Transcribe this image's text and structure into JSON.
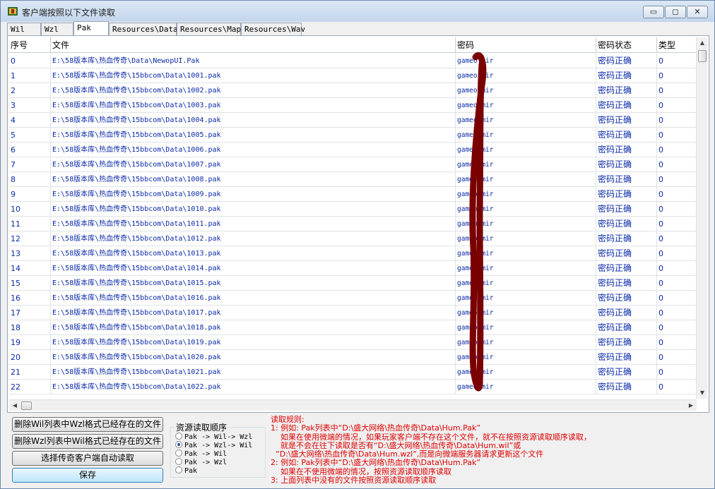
{
  "window": {
    "title": "客户端按照以下文件读取",
    "minimize": "▭",
    "maximize": "◻",
    "close": "✕",
    "app_icon": "legend-game-icon"
  },
  "tabs": [
    "Wil",
    "Wzl",
    "Pak",
    "Resources\\Data",
    "Resources\\Map",
    "Resources\\Wav"
  ],
  "active_tab": "Pak",
  "grid": {
    "headers": [
      "序号",
      "文件",
      "密码",
      "密码状态",
      "类型"
    ],
    "rows": [
      [
        "0",
        "E:\\58版本库\\热血传奇\\Data\\NewopUI.Pak",
        "gameofmir",
        "密码正确",
        "0"
      ],
      [
        "1",
        "E:\\58版本库\\热血传奇\\15bbcom\\Data\\1001.pak",
        "gameofmir",
        "密码正确",
        "0"
      ],
      [
        "2",
        "E:\\58版本库\\热血传奇\\15bbcom\\Data\\1002.pak",
        "gameofmir",
        "密码正确",
        "0"
      ],
      [
        "3",
        "E:\\58版本库\\热血传奇\\15bbcom\\Data\\1003.pak",
        "gameofmir",
        "密码正确",
        "0"
      ],
      [
        "4",
        "E:\\58版本库\\热血传奇\\15bbcom\\Data\\1004.pak",
        "gameofmir",
        "密码正确",
        "0"
      ],
      [
        "5",
        "E:\\58版本库\\热血传奇\\15bbcom\\Data\\1005.pak",
        "gameofmir",
        "密码正确",
        "0"
      ],
      [
        "6",
        "E:\\58版本库\\热血传奇\\15bbcom\\Data\\1006.pak",
        "gameofmir",
        "密码正确",
        "0"
      ],
      [
        "7",
        "E:\\58版本库\\热血传奇\\15bbcom\\Data\\1007.pak",
        "gameofmir",
        "密码正确",
        "0"
      ],
      [
        "8",
        "E:\\58版本库\\热血传奇\\15bbcom\\Data\\1008.pak",
        "gameofmir",
        "密码正确",
        "0"
      ],
      [
        "9",
        "E:\\58版本库\\热血传奇\\15bbcom\\Data\\1009.pak",
        "gameofmir",
        "密码正确",
        "0"
      ],
      [
        "10",
        "E:\\58版本库\\热血传奇\\15bbcom\\Data\\1010.pak",
        "gameofmir",
        "密码正确",
        "0"
      ],
      [
        "11",
        "E:\\58版本库\\热血传奇\\15bbcom\\Data\\1011.pak",
        "gameofmir",
        "密码正确",
        "0"
      ],
      [
        "12",
        "E:\\58版本库\\热血传奇\\15bbcom\\Data\\1012.pak",
        "gameofmir",
        "密码正确",
        "0"
      ],
      [
        "13",
        "E:\\58版本库\\热血传奇\\15bbcom\\Data\\1013.pak",
        "gameofmir",
        "密码正确",
        "0"
      ],
      [
        "14",
        "E:\\58版本库\\热血传奇\\15bbcom\\Data\\1014.pak",
        "gameofmir",
        "密码正确",
        "0"
      ],
      [
        "15",
        "E:\\58版本库\\热血传奇\\15bbcom\\Data\\1015.pak",
        "gameofmir",
        "密码正确",
        "0"
      ],
      [
        "16",
        "E:\\58版本库\\热血传奇\\15bbcom\\Data\\1016.pak",
        "gameofmir",
        "密码正确",
        "0"
      ],
      [
        "17",
        "E:\\58版本库\\热血传奇\\15bbcom\\Data\\1017.pak",
        "gameofmir",
        "密码正确",
        "0"
      ],
      [
        "18",
        "E:\\58版本库\\热血传奇\\15bbcom\\Data\\1018.pak",
        "gameofmir",
        "密码正确",
        "0"
      ],
      [
        "19",
        "E:\\58版本库\\热血传奇\\15bbcom\\Data\\1019.pak",
        "gameofmir",
        "密码正确",
        "0"
      ],
      [
        "20",
        "E:\\58版本库\\热血传奇\\15bbcom\\Data\\1020.pak",
        "gameofmir",
        "密码正确",
        "0"
      ],
      [
        "21",
        "E:\\58版本库\\热血传奇\\15bbcom\\Data\\1021.pak",
        "gameofmir",
        "密码正确",
        "0"
      ],
      [
        "22",
        "E:\\58版本库\\热血传奇\\15bbcom\\Data\\1022.pak",
        "gameofmir",
        "密码正确",
        "0"
      ]
    ]
  },
  "buttons": {
    "delete_wil": "删除Wil列表中Wzl格式已经存在的文件",
    "delete_wzl": "删除Wzl列表中Wil格式已经存在的文件",
    "auto_read": "选择传奇客户端自动读取",
    "save": "保存"
  },
  "read_order": {
    "title": "资源读取顺序",
    "options": [
      "Pak -> Wil-> Wzl",
      "Pak -> Wzl-> Wil",
      "Pak -> Wil",
      "Pak -> Wzl",
      "Pak"
    ],
    "selected_index": 1
  },
  "rules_text": "读取规则:\n1: 例如: Pak列表中“D:\\盛大网络\\热血传奇\\Data\\Hum.Pak”\n    如果在使用微端的情况，如果玩家客户端不存在这个文件，就不在按照资源读取顺序读取，\n    就是不会在往下读取是否有“D:\\盛大网络\\热血传奇\\Data\\Hum.wil”或\n  “D:\\盛大网络\\热血传奇\\Data\\Hum.wzl”,而是向微端服务器请求更新这个文件\n2: 例如: Pak列表中“D:\\盛大网络\\热血传奇\\Data\\Hum.Pak”\n    如果在不使用微端的情况，按照资源读取顺序读取\n3: 上面列表中没有的文件按照资源读取顺序读取",
  "colors": {
    "grid_text": "#0a2aa8",
    "rules_text": "#e00000",
    "scribble": "#7a0000"
  }
}
